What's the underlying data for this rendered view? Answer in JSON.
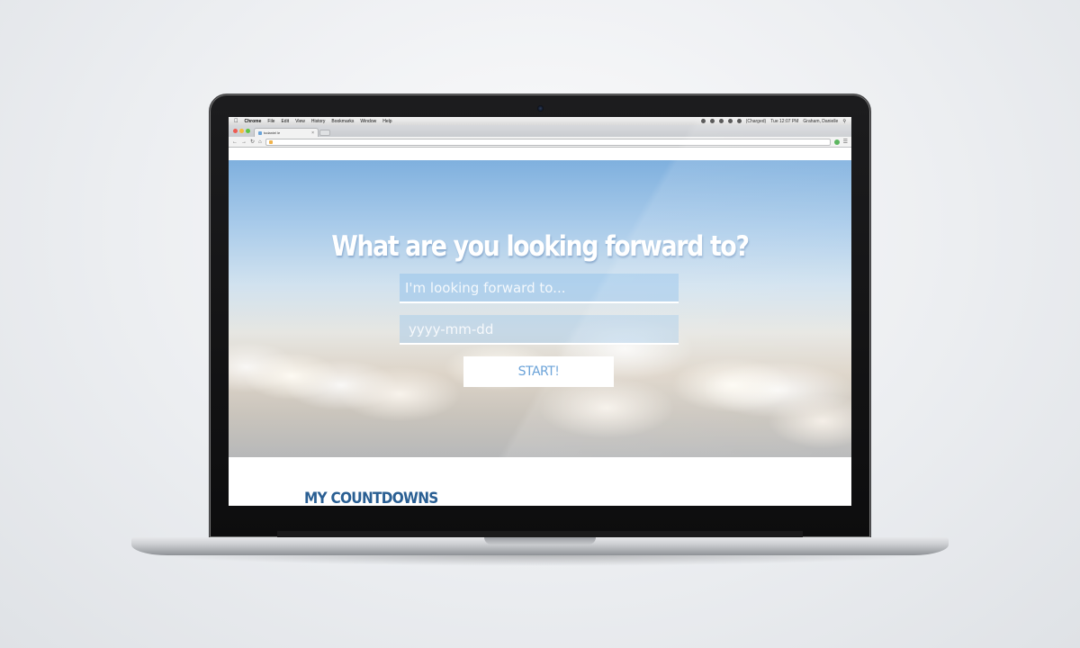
{
  "menubar": {
    "apple_icon": "apple-icon",
    "items": [
      "Chrome",
      "File",
      "Edit",
      "View",
      "History",
      "Bookmarks",
      "Window",
      "Help"
    ],
    "clock": "Tue 12:07 PM",
    "user": "Graham, Danielle",
    "charge": "(Charged)"
  },
  "browser": {
    "tab_title": "todaniel le",
    "tab_close": "×"
  },
  "page": {
    "headline": "What are you looking forward to?",
    "goal_placeholder": "I'm looking forward to...",
    "date_placeholder": "yyyy-mm-dd",
    "start_label": "START!",
    "section_title": "MY COUNTDOWNS"
  },
  "colors": {
    "accent": "#6aa2d8",
    "section_title": "#2a5f93"
  }
}
